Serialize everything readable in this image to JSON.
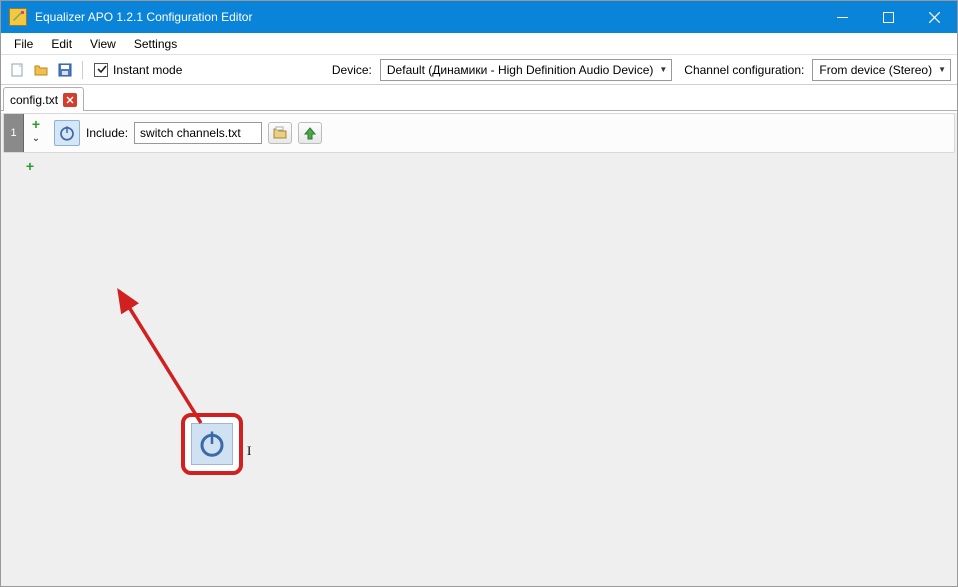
{
  "window": {
    "title": "Equalizer APO 1.2.1 Configuration Editor"
  },
  "menubar": {
    "items": [
      "File",
      "Edit",
      "View",
      "Settings"
    ]
  },
  "toolbar": {
    "instant_mode_label": "Instant mode",
    "instant_mode_checked": true,
    "device_label": "Device:",
    "device_value": "Default (Динамики - High Definition Audio Device)",
    "channel_cfg_label": "Channel configuration:",
    "channel_cfg_value": "From device (Stereo)"
  },
  "tabs": [
    {
      "label": "config.txt"
    }
  ],
  "editor": {
    "rows": [
      {
        "index": "1",
        "type_label": "Include:",
        "include_value": "switch channels.txt"
      }
    ]
  },
  "icons": {
    "new": "new-file-icon",
    "open": "open-folder-icon",
    "save": "save-icon",
    "power": "power-icon",
    "file_open": "file-open-icon",
    "arrow_up": "arrow-up-icon"
  },
  "colors": {
    "titlebar": "#0a84d8",
    "accent_red": "#d02020",
    "plus_green": "#2a9d2a"
  }
}
